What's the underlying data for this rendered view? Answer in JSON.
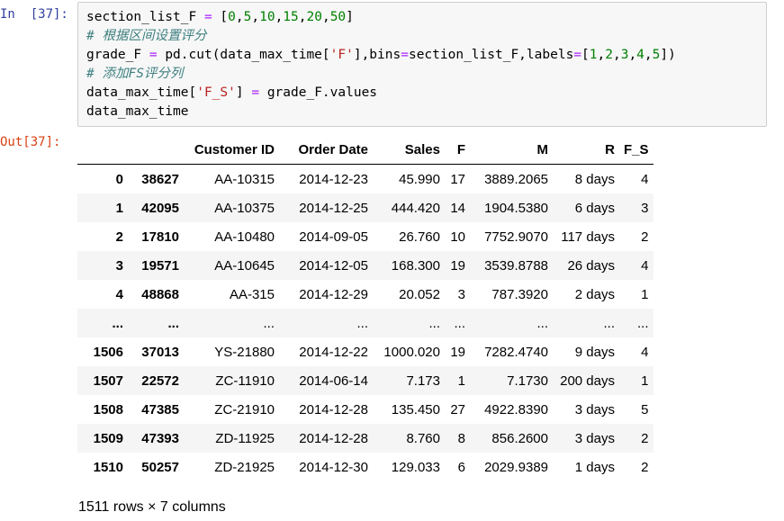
{
  "cell": {
    "in_prompt": "In  [37]:",
    "out_prompt": "Out[37]:",
    "code_lines": [
      [
        {
          "t": "section_list_F",
          "c": "c-var"
        },
        {
          "t": " = ",
          "c": "c-op"
        },
        {
          "t": "[",
          "c": "c-var"
        },
        {
          "t": "0",
          "c": "c-num"
        },
        {
          "t": ",",
          "c": "c-var"
        },
        {
          "t": "5",
          "c": "c-num"
        },
        {
          "t": ",",
          "c": "c-var"
        },
        {
          "t": "10",
          "c": "c-num"
        },
        {
          "t": ",",
          "c": "c-var"
        },
        {
          "t": "15",
          "c": "c-num"
        },
        {
          "t": ",",
          "c": "c-var"
        },
        {
          "t": "20",
          "c": "c-num"
        },
        {
          "t": ",",
          "c": "c-var"
        },
        {
          "t": "50",
          "c": "c-num"
        },
        {
          "t": "]",
          "c": "c-var"
        }
      ],
      [
        {
          "t": "# 根据区间设置评分",
          "c": "c-comment"
        }
      ],
      [
        {
          "t": "grade_F",
          "c": "c-var"
        },
        {
          "t": " = ",
          "c": "c-op"
        },
        {
          "t": "pd.cut(data_max_time[",
          "c": "c-var"
        },
        {
          "t": "'F'",
          "c": "c-str"
        },
        {
          "t": "],bins",
          "c": "c-var"
        },
        {
          "t": "=",
          "c": "c-op"
        },
        {
          "t": "section_list_F,labels",
          "c": "c-var"
        },
        {
          "t": "=",
          "c": "c-op"
        },
        {
          "t": "[",
          "c": "c-var"
        },
        {
          "t": "1",
          "c": "c-num"
        },
        {
          "t": ",",
          "c": "c-var"
        },
        {
          "t": "2",
          "c": "c-num"
        },
        {
          "t": ",",
          "c": "c-var"
        },
        {
          "t": "3",
          "c": "c-num"
        },
        {
          "t": ",",
          "c": "c-var"
        },
        {
          "t": "4",
          "c": "c-num"
        },
        {
          "t": ",",
          "c": "c-var"
        },
        {
          "t": "5",
          "c": "c-num"
        },
        {
          "t": "])",
          "c": "c-var"
        }
      ],
      [
        {
          "t": "# 添加FS评分列",
          "c": "c-comment"
        }
      ],
      [
        {
          "t": "data_max_time[",
          "c": "c-var"
        },
        {
          "t": "'F_S'",
          "c": "c-str"
        },
        {
          "t": "]",
          "c": "c-var"
        },
        {
          "t": " = ",
          "c": "c-op"
        },
        {
          "t": "grade_F.values",
          "c": "c-var"
        }
      ],
      [
        {
          "t": "data_max_time",
          "c": "c-var"
        }
      ]
    ]
  },
  "dataframe": {
    "columns": [
      "",
      "",
      "Customer ID",
      "Order Date",
      "Sales",
      "F",
      "M",
      "R",
      "F_S"
    ],
    "rows": [
      [
        "0",
        "38627",
        "AA-10315",
        "2014-12-23",
        "45.990",
        "17",
        "3889.2065",
        "8 days",
        "4"
      ],
      [
        "1",
        "42095",
        "AA-10375",
        "2014-12-25",
        "444.420",
        "14",
        "1904.5380",
        "6 days",
        "3"
      ],
      [
        "2",
        "17810",
        "AA-10480",
        "2014-09-05",
        "26.760",
        "10",
        "7752.9070",
        "117 days",
        "2"
      ],
      [
        "3",
        "19571",
        "AA-10645",
        "2014-12-05",
        "168.300",
        "19",
        "3539.8788",
        "26 days",
        "4"
      ],
      [
        "4",
        "48868",
        "AA-315",
        "2014-12-29",
        "20.052",
        "3",
        "787.3920",
        "2 days",
        "1"
      ],
      [
        "...",
        "...",
        "...",
        "...",
        "...",
        "...",
        "...",
        "...",
        "..."
      ],
      [
        "1506",
        "37013",
        "YS-21880",
        "2014-12-22",
        "1000.020",
        "19",
        "7282.4740",
        "9 days",
        "4"
      ],
      [
        "1507",
        "22572",
        "ZC-11910",
        "2014-06-14",
        "7.173",
        "1",
        "7.1730",
        "200 days",
        "1"
      ],
      [
        "1508",
        "47385",
        "ZC-21910",
        "2014-12-28",
        "135.450",
        "27",
        "4922.8390",
        "3 days",
        "5"
      ],
      [
        "1509",
        "47393",
        "ZD-11925",
        "2014-12-28",
        "8.760",
        "8",
        "856.2600",
        "3 days",
        "2"
      ],
      [
        "1510",
        "50257",
        "ZD-21925",
        "2014-12-30",
        "129.033",
        "6",
        "2029.9389",
        "1 days",
        "2"
      ]
    ],
    "shape": "1511 rows × 7 columns"
  }
}
